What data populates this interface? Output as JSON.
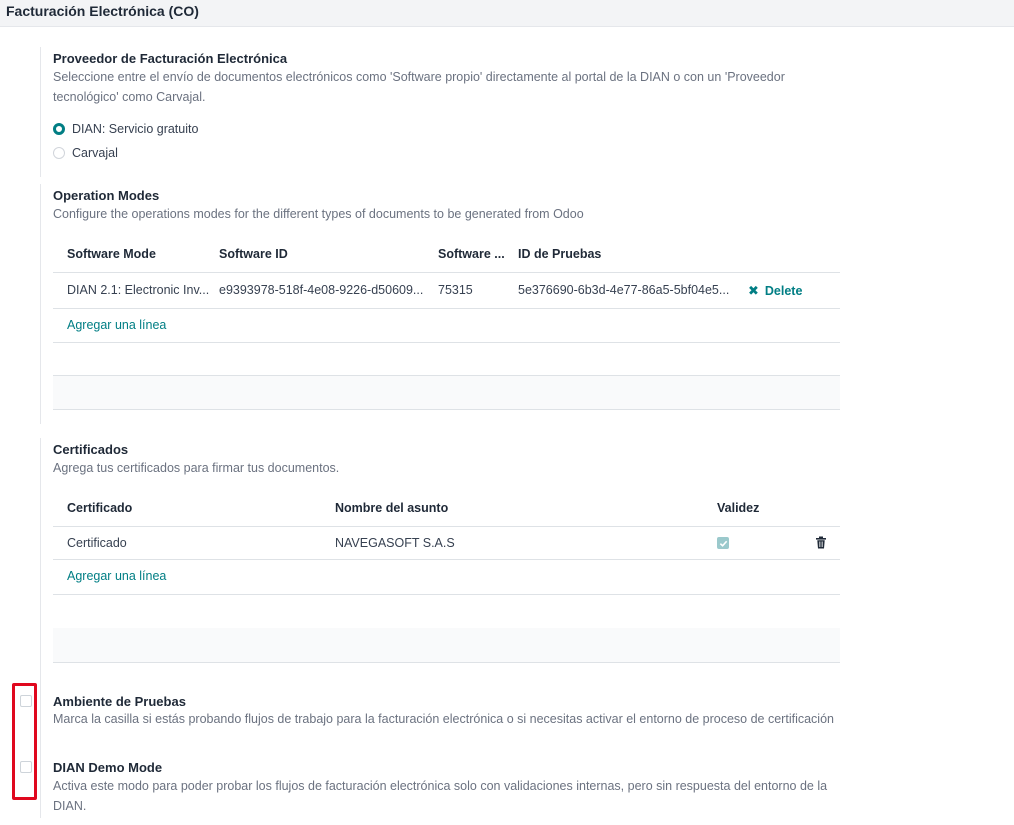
{
  "header": {
    "title": "Facturación Electrónica (CO)"
  },
  "provider": {
    "title": "Proveedor de Facturación Electrónica",
    "desc_line1": "Seleccione entre el envío de documentos electrónicos como 'Software propio' directamente al portal de la DIAN o con un 'Proveedor",
    "desc_line2": "tecnológico' como Carvajal.",
    "options": [
      {
        "label": "DIAN: Servicio gratuito",
        "selected": true
      },
      {
        "label": "Carvajal",
        "selected": false
      }
    ]
  },
  "operation_modes": {
    "title": "Operation Modes",
    "desc": "Configure the operations modes for the different types of documents to be generated from Odoo",
    "columns": [
      "Software Mode",
      "Software ID",
      "Software ...",
      "ID de Pruebas"
    ],
    "rows": [
      {
        "software_mode": "DIAN 2.1: Electronic Inv...",
        "software_id": "e9393978-518f-4e08-9226-d50609...",
        "software_pin": "75315",
        "test_id": "5e376690-6b3d-4e77-86a5-5bf04e5...",
        "delete_label": "Delete"
      }
    ],
    "add_line": "Agregar una línea"
  },
  "certificates": {
    "title": "Certificados",
    "desc": "Agrega tus certificados para firmar tus documentos.",
    "columns": [
      "Certificado",
      "Nombre del asunto",
      "Validez"
    ],
    "rows": [
      {
        "certificate": "Certificado",
        "subject": "NAVEGASOFT S.A.S",
        "valid": true
      }
    ],
    "add_line": "Agregar una línea"
  },
  "test_environment": {
    "title": "Ambiente de Pruebas",
    "desc": "Marca la casilla si estás probando flujos de trabajo para la facturación electrónica o si necesitas activar el entorno de proceso de certificación",
    "checked": false
  },
  "demo_mode": {
    "title": "DIAN Demo Mode",
    "desc_line1": "Activa este modo para poder probar los flujos de facturación electrónica solo con validaciones internas, pero sin respuesta del entorno de la",
    "desc_line2": "DIAN.",
    "checked": false
  },
  "colors": {
    "accent": "#017e84",
    "highlight": "#e0081e",
    "header_bg": "#f3f4f6"
  },
  "icons": {
    "delete": "x-icon",
    "trash": "trash-icon",
    "valid": "check-icon"
  }
}
